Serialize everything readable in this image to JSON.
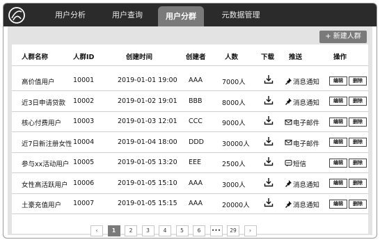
{
  "nav": {
    "tabs": [
      {
        "label": "用户分析",
        "active": false
      },
      {
        "label": "用户查询",
        "active": false
      },
      {
        "label": "用户分群",
        "active": true
      },
      {
        "label": "元数据管理",
        "active": false
      }
    ]
  },
  "toolbar": {
    "new_group_label": "+ 新建人群"
  },
  "table": {
    "headers": [
      "人群名称",
      "人群ID",
      "创建时间",
      "创建者",
      "人数",
      "下载",
      "推送",
      "操作"
    ],
    "rows": [
      {
        "name": "高价值用户",
        "id": "10001",
        "created": "2019-01-01 19:00",
        "creator": "AAA",
        "count": "7000人",
        "push_icon": "pin-icon",
        "push": "消息通知"
      },
      {
        "name": "近3日申请贷款",
        "id": "10002",
        "created": "2019-01-02 19:01",
        "creator": "BBB",
        "count": "8000人",
        "push_icon": "pin-icon",
        "push": "消息通知"
      },
      {
        "name": "核心付费用户",
        "id": "10003",
        "created": "2019-01-03 12:01",
        "creator": "CCC",
        "count": "9000人",
        "push_icon": "mail-icon",
        "push": "电子邮件"
      },
      {
        "name": "近7日新注册女性",
        "id": "10004",
        "created": "2019-01-04 18:00",
        "creator": "DDD",
        "count": "30000人",
        "push_icon": "mail-icon",
        "push": "电子邮件"
      },
      {
        "name": "参与xx活动用户",
        "id": "10005",
        "created": "2019-01-05 13:20",
        "creator": "EEE",
        "count": "2500人",
        "push_icon": "sms-icon",
        "push": "短信"
      },
      {
        "name": "女性高活跃用户",
        "id": "10006",
        "created": "2019-01-05 15:10",
        "creator": "AAA",
        "count": "3000人",
        "push_icon": "pin-icon",
        "push": "消息通知"
      },
      {
        "name": "土豪充值用户",
        "id": "10007",
        "created": "2019-01-05 15:15",
        "creator": "AAA",
        "count": "20000人",
        "push_icon": "pin-icon",
        "push": "消息通知"
      }
    ],
    "edit_label": "编辑",
    "delete_label": "删除"
  },
  "pagination": {
    "prev": "‹",
    "pages": [
      "1",
      "2",
      "3",
      "4",
      "5",
      "6",
      "•••",
      "29"
    ],
    "current": "1",
    "next": "›"
  }
}
